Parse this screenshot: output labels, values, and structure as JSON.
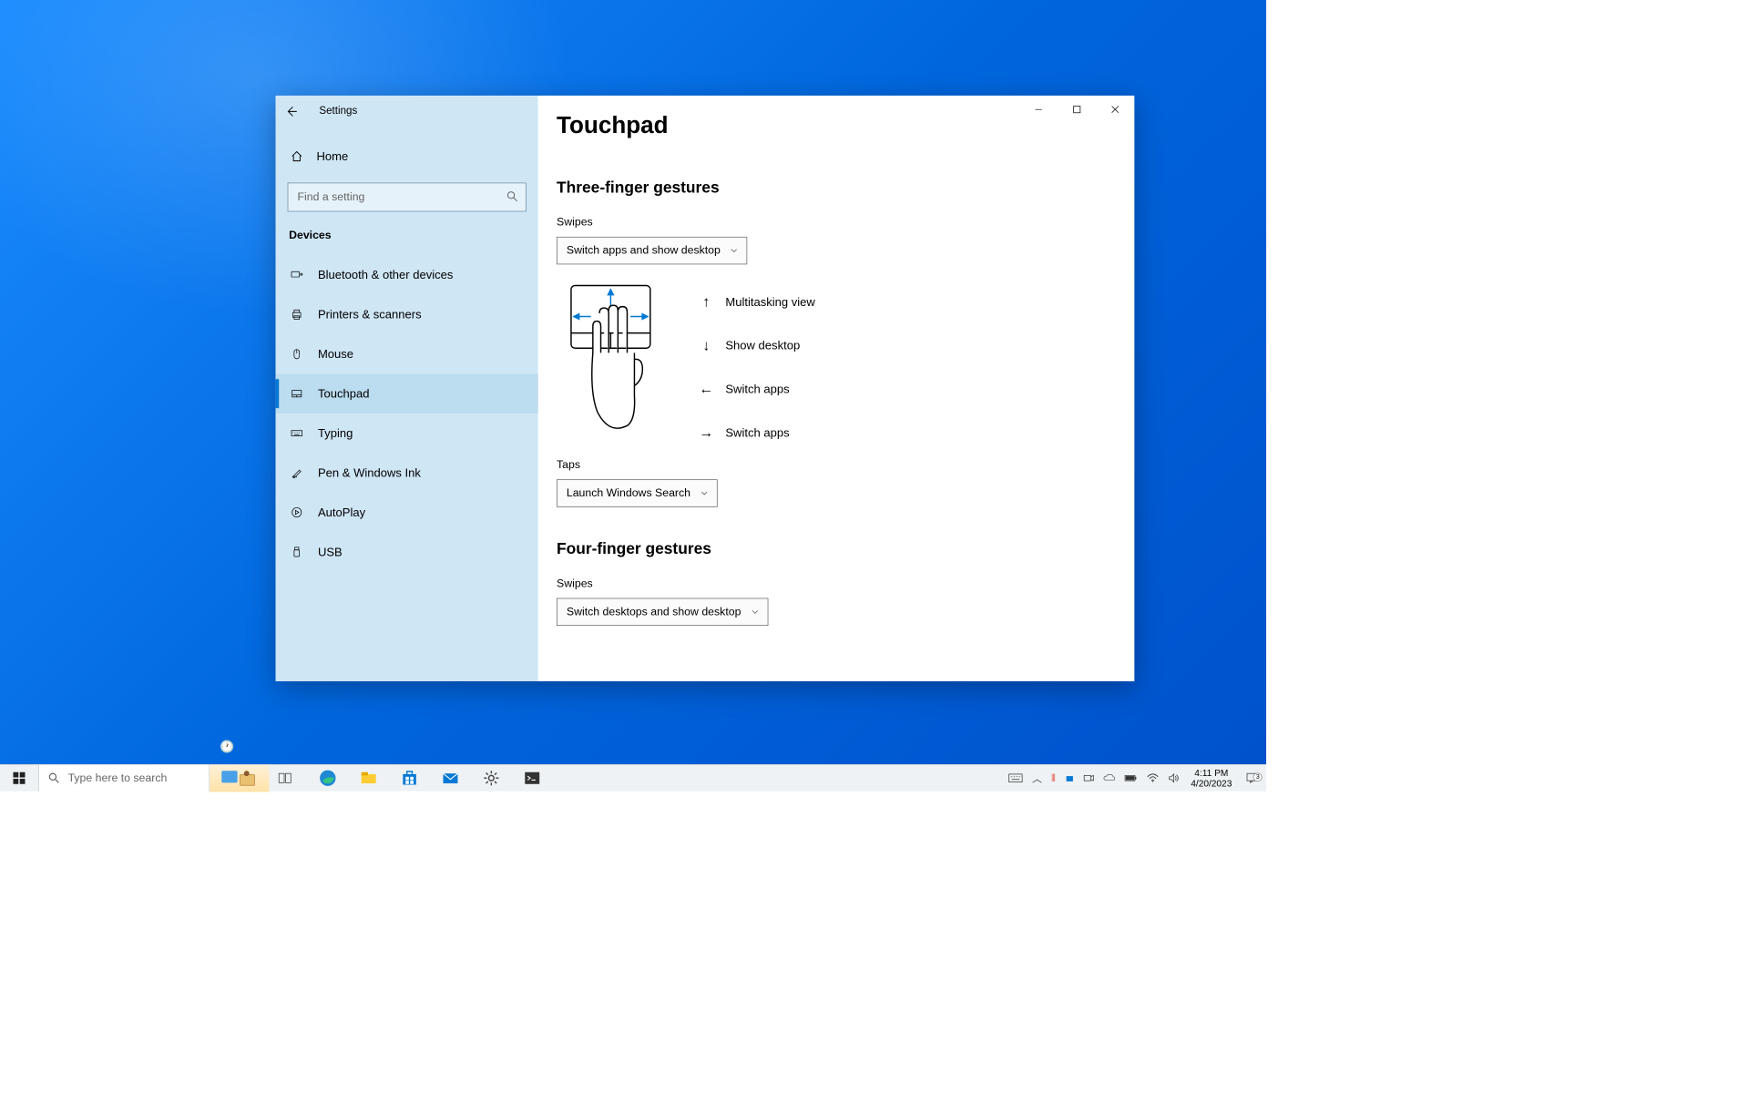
{
  "window": {
    "title": "Settings",
    "home": "Home",
    "search_placeholder": "Find a setting",
    "category": "Devices"
  },
  "nav": [
    {
      "id": "bluetooth",
      "label": "Bluetooth & other devices"
    },
    {
      "id": "printers",
      "label": "Printers & scanners"
    },
    {
      "id": "mouse",
      "label": "Mouse"
    },
    {
      "id": "touchpad",
      "label": "Touchpad"
    },
    {
      "id": "typing",
      "label": "Typing"
    },
    {
      "id": "pen",
      "label": "Pen & Windows Ink"
    },
    {
      "id": "autoplay",
      "label": "AutoPlay"
    },
    {
      "id": "usb",
      "label": "USB"
    }
  ],
  "page": {
    "title": "Touchpad",
    "three_finger": {
      "heading": "Three-finger gestures",
      "swipes_label": "Swipes",
      "swipes_value": "Switch apps and show desktop",
      "gestures": [
        {
          "dir": "up",
          "label": "Multitasking view"
        },
        {
          "dir": "down",
          "label": "Show desktop"
        },
        {
          "dir": "left",
          "label": "Switch apps"
        },
        {
          "dir": "right",
          "label": "Switch apps"
        }
      ],
      "taps_label": "Taps",
      "taps_value": "Launch Windows Search"
    },
    "four_finger": {
      "heading": "Four-finger gestures",
      "swipes_label": "Swipes",
      "swipes_value": "Switch desktops and show desktop"
    }
  },
  "taskbar": {
    "search_placeholder": "Type here to search",
    "time": "4:11 PM",
    "date": "4/20/2023",
    "action_count": "3"
  }
}
